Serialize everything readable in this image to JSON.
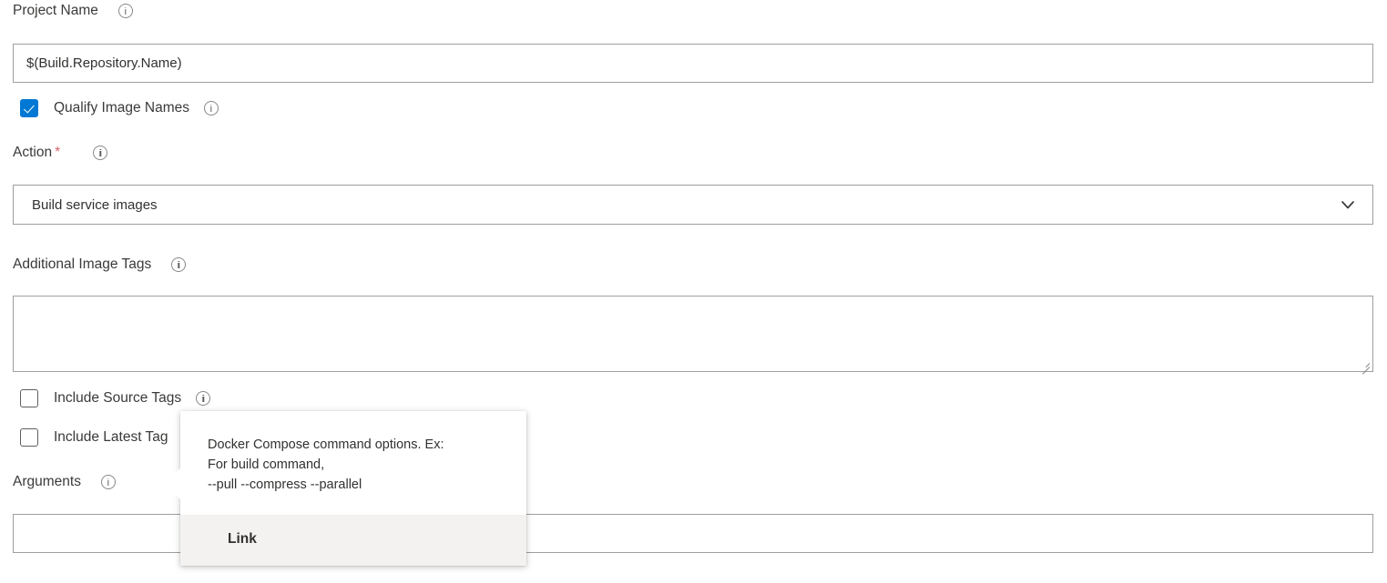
{
  "form": {
    "fields": [
      {
        "label": "Project Name",
        "required": false,
        "info_icon": "info-icon",
        "type": "text",
        "value": "$(Build.Repository.Name)",
        "placeholder": ""
      },
      {
        "label": "Action",
        "required": true,
        "required_marker": "*",
        "info_icon": "info-icon",
        "type": "dropdown",
        "value": "Build service images",
        "chevron_icon": "chevron-down-icon"
      },
      {
        "label": "Additional Image Tags",
        "required": false,
        "info_icon": "info-icon",
        "type": "textarea",
        "value": "",
        "placeholder": ""
      },
      {
        "label": "Arguments",
        "required": false,
        "info_icon": "info-icon",
        "type": "text",
        "value": "",
        "placeholder": ""
      }
    ],
    "checkboxes": [
      {
        "label": "Qualify Image Names",
        "checked": true,
        "info_icon": "info-icon"
      },
      {
        "label": "Include Source Tags",
        "checked": false,
        "info_icon": "info-icon"
      },
      {
        "label": "Include Latest Tag",
        "checked": false,
        "info_icon": "info-icon"
      }
    ]
  },
  "tooltip": {
    "lines": [
      "Docker Compose command options. Ex:",
      "For build command,",
      "--pull --compress --parallel"
    ],
    "link_label": "Link"
  },
  "colors": {
    "accent": "#0078d4",
    "required_star": "#d6656a",
    "border": "#a19f9d",
    "text": "#323130",
    "footer_bg": "#f3f2f1"
  }
}
